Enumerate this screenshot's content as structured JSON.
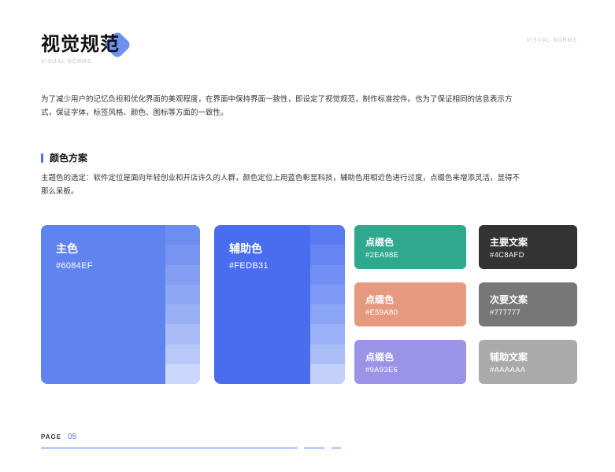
{
  "header": {
    "title": "视觉规范",
    "subtitle": "VISUAL NORMS",
    "corner_label": "VISUAL NORMS"
  },
  "intro": "为了减少用户的记忆负担和优化界面的美观程度，在界面中保持界面一致性，即设定了视觉规范，制作标准控件。也为了保证相同的信息表示方式，保证字体，标签风格、颜色、图标等方面的一致性。",
  "section": {
    "title": "颜色方案",
    "description": "主题色的选定：软件定位是面向年轻创业和开店许久的人群，颜色定位上用蓝色彰显科技，辅助色用相近色进行过度，点缀色来增添灵活，显得不那么呆板。"
  },
  "main_color": {
    "name": "主色",
    "hex": "#6084EF",
    "color": "#6084EF",
    "shades": [
      "#6D8EF1",
      "#7895F2",
      "#839EF3",
      "#8EA7F4",
      "#99B0F5",
      "#A9BCF7",
      "#B8C8F9",
      "#CCD8FB"
    ]
  },
  "aux_color": {
    "name": "辅助色",
    "hex": "#FEDB31",
    "color": "#4A6DF0",
    "shades": [
      "#5A7AF2",
      "#6685F3",
      "#7290F4",
      "#7E9AF5",
      "#8AA4F6",
      "#9AB1F7",
      "#ABBEF8",
      "#C3D1FA"
    ]
  },
  "accent_colors": [
    {
      "name": "点缀色",
      "hex": "#2EA98E",
      "color": "#2EA98E"
    },
    {
      "name": "点缀色",
      "hex": "#E59A80",
      "color": "#E59A80"
    },
    {
      "name": "点缀色",
      "hex": "#9A93E6",
      "color": "#9A93E6"
    }
  ],
  "text_colors": [
    {
      "name": "主要文案",
      "hex": "#4C8AFD",
      "color": "#333333"
    },
    {
      "name": "次要文案",
      "hex": "#777777",
      "color": "#777777"
    },
    {
      "name": "辅助文案",
      "hex": "#AAAAAA",
      "color": "#AAAAAA"
    }
  ],
  "footer": {
    "page_label": "PAGE",
    "page_number": "05"
  }
}
